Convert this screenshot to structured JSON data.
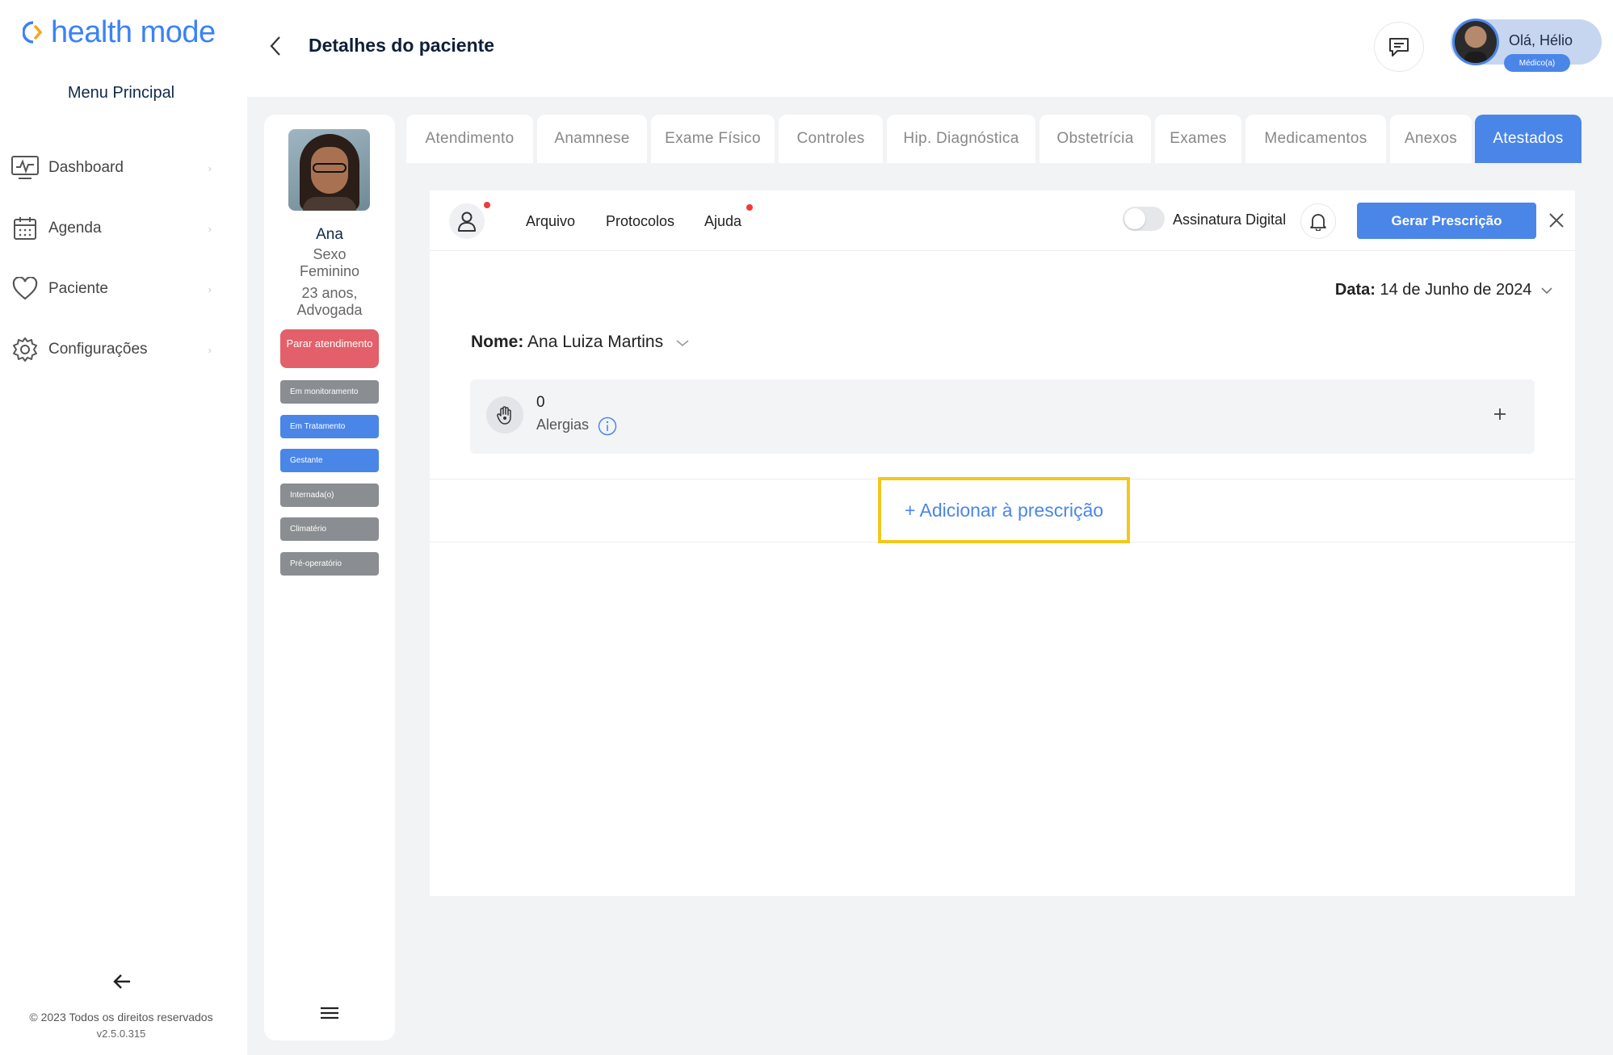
{
  "app": {
    "logo_text": "health mode",
    "brand_color": "#3b82f6"
  },
  "sidebar": {
    "menu_title": "Menu Principal",
    "items": [
      {
        "label": "Dashboard",
        "icon": "dashboard-icon"
      },
      {
        "label": "Agenda",
        "icon": "calendar-icon"
      },
      {
        "label": "Paciente",
        "icon": "heart-icon"
      },
      {
        "label": "Configurações",
        "icon": "gear-icon"
      }
    ],
    "copyright": "© 2023 Todos os direitos reservados",
    "version": "v2.5.0.315"
  },
  "header": {
    "title": "Detalhes do paciente",
    "greeting": "Olá, Hélio",
    "role": "Médico(a)"
  },
  "patient": {
    "name": "Ana",
    "sex_label": "Sexo",
    "sex": "Feminino",
    "age": "23 anos,",
    "profession": "Advogada",
    "stop_button": "Parar atendimento",
    "tags": [
      {
        "label": "Em monitoramento",
        "color": "#8a8d91"
      },
      {
        "label": "Em Tratamento",
        "color": "#4a86e8"
      },
      {
        "label": "Gestante",
        "color": "#4a86e8"
      },
      {
        "label": "Internada(o)",
        "color": "#8a8d91"
      },
      {
        "label": "Climatério",
        "color": "#8a8d91"
      },
      {
        "label": "Pré-operatório",
        "color": "#8a8d91"
      }
    ]
  },
  "tabs": [
    {
      "label": "Atendimento",
      "active": false
    },
    {
      "label": "Anamnese",
      "active": false
    },
    {
      "label": "Exame Físico",
      "active": false
    },
    {
      "label": "Controles",
      "active": false
    },
    {
      "label": "Hip. Diagnóstica",
      "active": false
    },
    {
      "label": "Obstetrícia",
      "active": false
    },
    {
      "label": "Exames",
      "active": false
    },
    {
      "label": "Medicamentos",
      "active": false
    },
    {
      "label": "Anexos",
      "active": false
    },
    {
      "label": "Atestados",
      "active": true
    }
  ],
  "prescription": {
    "menu": [
      "Arquivo",
      "Protocolos",
      "Ajuda"
    ],
    "toggle_label": "Assinatura Digital",
    "toggle_on": false,
    "generate_button": "Gerar Prescrição",
    "date_label": "Data:",
    "date_value": "14 de Junho de 2024",
    "name_label": "Nome:",
    "name_value": "Ana Luiza Martins",
    "allergy_count": "0",
    "allergy_label": "Alergias",
    "add_label": "+ Adicionar à prescrição",
    "accent": "#4a86e8",
    "highlight": "#f2c81b"
  }
}
